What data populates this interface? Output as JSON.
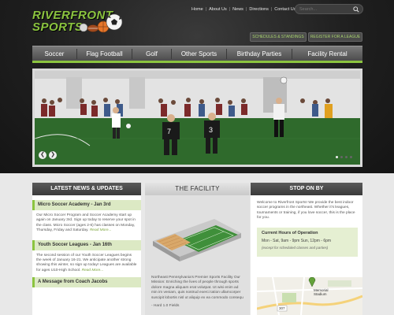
{
  "brand": {
    "line1": "RIVERFRONT",
    "line2": "SPORTS"
  },
  "topnav": [
    "Home",
    "About Us",
    "News",
    "Directions",
    "Contact Us"
  ],
  "search": {
    "placeholder": "Search..."
  },
  "header_buttons": {
    "schedules": "SCHEDULES & STANDINGS",
    "register": "REGISTER FOR A LEAGUE"
  },
  "mainnav": [
    "Soccer",
    "Flag Football",
    "Golf",
    "Other Sports",
    "Birthday Parties",
    "Facility Rental"
  ],
  "slider": {
    "arrow_prev": "❮",
    "arrow_next": "❯"
  },
  "news": {
    "heading": "LATEST NEWS & UPDATES",
    "items": [
      {
        "title": "Micro Soccer Academy - Jan 3rd",
        "body": "Our Micro Soccer Program and Soccer Academy start up again on January 3rd.  Sign up today to reserve your spot in the class.  Micro Soccer (ages 2-6) has classes on Monday, Thursday, Friday and Saturday.",
        "more": "Read More..."
      },
      {
        "title": "Youth Soccer Leagues - Jan 16th",
        "body": "The second session of our Youth Soccer Leagues begins the week of January 16-21.  We anticipate another strong showing this winter, so sign up today!  Leagues are available for ages U10-High School.",
        "more": "Read More..."
      },
      {
        "title": "A Message from Coach Jacobs",
        "body": "",
        "more": ""
      }
    ]
  },
  "facility": {
    "heading": "THE FACILITY",
    "text": "Northeast Pennsylvania's Premier Sports Facility  Our Mission:  Enriching the lives of people through sports dolore magna aliquam erat volutpat. Ut wisi enim ad min im veniam, quis nostrud exerci tation ullamcorper suscipit lobortis nisl ut aliquip ex ea commodo consequ",
    "list_item": "- Hard 1.0 Fields"
  },
  "stop": {
    "heading": "STOP ON BY",
    "intro": "Welcome to Riverfront Sports! We provide the best indoor soccer programs in the northeast. Whether it's leagues, tournaments or training, if you love soccer, this is the place for you.",
    "hours_title": "Current Hours of Operation",
    "hours_line": "Mon - Sat,  9am - 9pm   Sun, 12pm - 6pm",
    "hours_note": "(except for scheduled classes and parties)",
    "map_label1": "Memorial",
    "map_label2": "Stadium",
    "map_road": "307"
  },
  "colors": {
    "brand_green": "#8bc43f",
    "dark": "#1f1f1f"
  }
}
